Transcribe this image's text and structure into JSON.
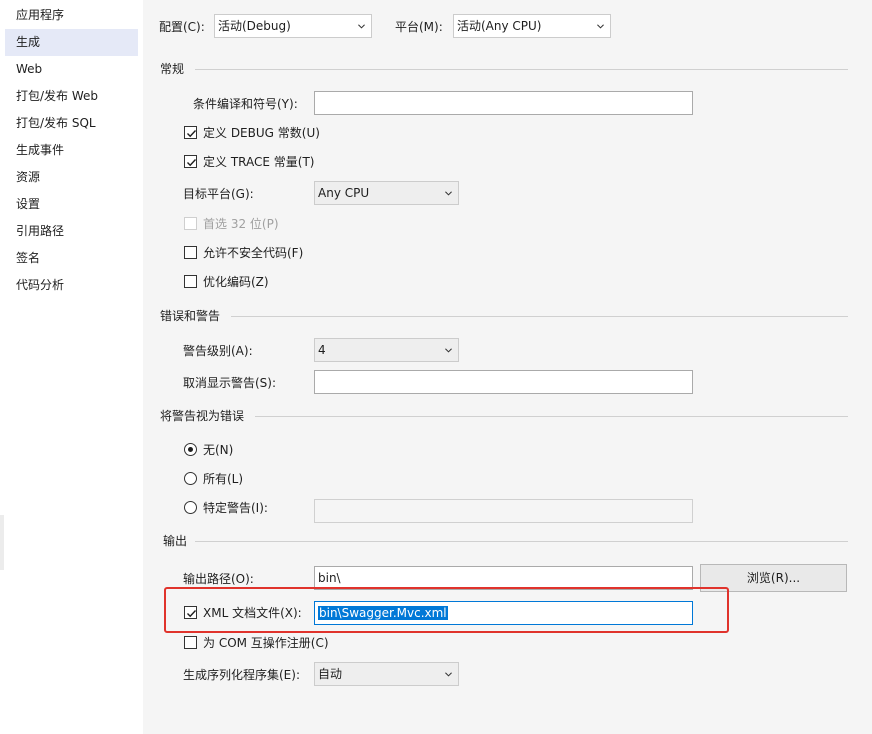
{
  "sidebar": {
    "items": [
      {
        "label": "应用程序"
      },
      {
        "label": "生成"
      },
      {
        "label": "Web"
      },
      {
        "label": "打包/发布 Web"
      },
      {
        "label": "打包/发布 SQL"
      },
      {
        "label": "生成事件"
      },
      {
        "label": "资源"
      },
      {
        "label": "设置"
      },
      {
        "label": "引用路径"
      },
      {
        "label": "签名"
      },
      {
        "label": "代码分析"
      }
    ],
    "selected": "生成"
  },
  "top": {
    "config_label": "配置(C):",
    "config_value": "活动(Debug)",
    "platform_label": "平台(M):",
    "platform_value": "活动(Any CPU)"
  },
  "general": {
    "title": "常规",
    "symbols_label": "条件编译和符号(Y):",
    "symbols_value": "",
    "define_debug_label": "定义 DEBUG 常数(U)",
    "define_debug_checked": true,
    "define_trace_label": "定义 TRACE 常量(T)",
    "define_trace_checked": true,
    "target_platform_label": "目标平台(G):",
    "target_platform_value": "Any CPU",
    "prefer32_label": "首选 32 位(P)",
    "prefer32_checked": false,
    "unsafe_label": "允许不安全代码(F)",
    "unsafe_checked": false,
    "optimize_label": "优化编码(Z)",
    "optimize_checked": false
  },
  "errors": {
    "title": "错误和警告",
    "warning_level_label": "警告级别(A):",
    "warning_level_value": "4",
    "suppress_label": "取消显示警告(S):",
    "suppress_value": ""
  },
  "treat_warnings": {
    "title": "将警告视为错误",
    "none_label": "无(N)",
    "all_label": "所有(L)",
    "specific_label": "特定警告(I):",
    "specific_value": "",
    "selected": "无(N)"
  },
  "output": {
    "title": "输出",
    "path_label": "输出路径(O):",
    "path_value": "bin\\",
    "browse_label": "浏览(R)...",
    "xml_label": "XML 文档文件(X):",
    "xml_checked": true,
    "xml_value": "bin\\Swagger.Mvc.xml",
    "com_label": "为 COM 互操作注册(C)",
    "com_checked": false,
    "serialization_label": "生成序列化程序集(E):",
    "serialization_value": "自动"
  },
  "colors": {
    "accent": "#0078d7",
    "highlight": "#e0332c",
    "selected_nav": "#e5e9f7"
  }
}
